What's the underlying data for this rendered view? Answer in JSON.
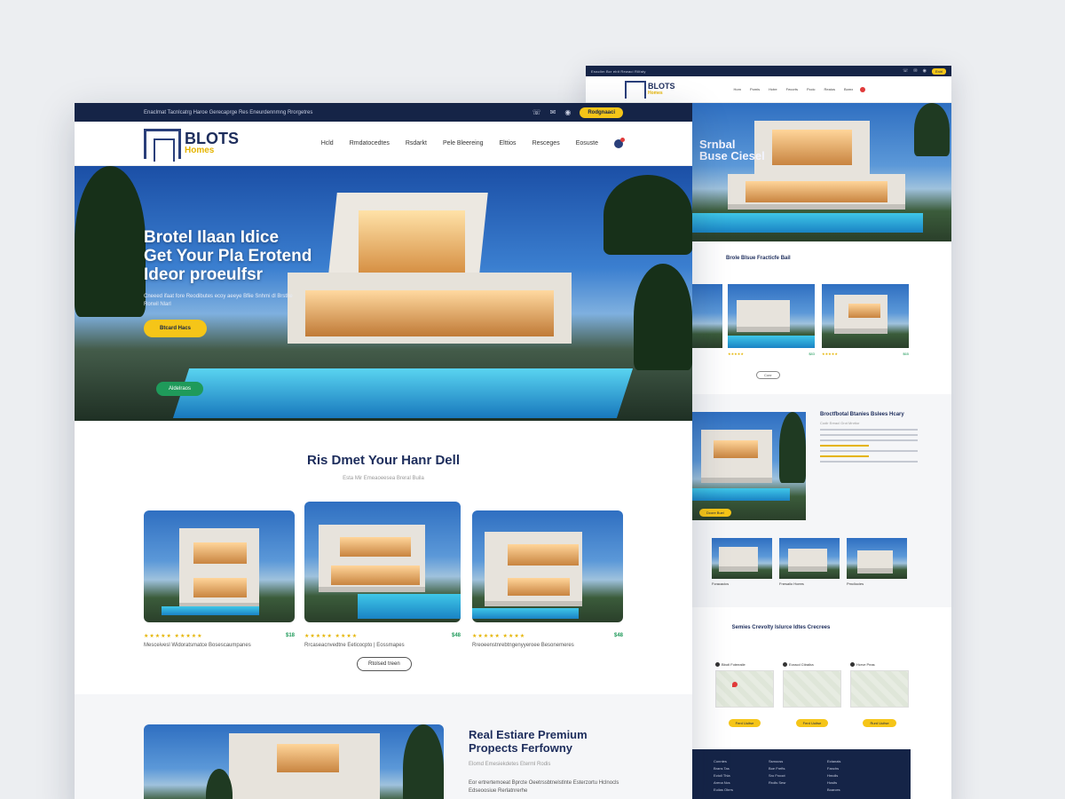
{
  "back": {
    "topbar": {
      "text": "Enaclim Bcr ebit Rewaci Rilfaty",
      "cta": "Enirl"
    },
    "logo": {
      "name": "BLOTS",
      "sub": "Homes"
    },
    "nav": [
      "Hom",
      "Pomis",
      "Hctre",
      "Fecorts",
      "Pccic",
      "Reaios",
      "Bomx"
    ],
    "hero_text": [
      "Srnbal",
      "Buse Ciesel"
    ],
    "featured_title": "Brole Blsue Fracticfe Bail",
    "cards": [
      {
        "price": "$83"
      },
      {
        "price": "$65"
      },
      {
        "price": "$29"
      }
    ],
    "view_more": "Conr",
    "feature": {
      "title": "Broctfbotal Btanies Bslees Hcary",
      "sub": "Codir Ereacl Grot Mnrtior",
      "button": "Dcore Buel"
    },
    "thumbs": [
      "Fcracacics",
      "Fnesaiio Hoees",
      "Pmcliocies"
    ],
    "locations_title": "Semies Crevolty Islurce Idtes Crecrees",
    "locations": [
      {
        "label": "Bbotl Foteeaile",
        "button": "Ferd Uuitse"
      },
      {
        "label": "Eoracd Ctiraiba",
        "button": "Ferd Uuitse"
      },
      {
        "label": "Hcrve Peas",
        "button": "Rurd Uuitse"
      }
    ],
    "footer": [
      [
        "Conntes",
        "Brans Tas",
        "Ectoll Thla",
        "Arena Ncs",
        "Euilas Obrrs"
      ],
      [
        "Ssmocss",
        "Boe Frefts",
        "Sro Frooct",
        "Rrolls Sesr"
      ],
      [
        "Ectanais",
        "Fanchs",
        "Hmolls",
        "Hosits",
        "Boarces"
      ]
    ]
  },
  "front": {
    "topbar": {
      "text": "Enaclmat Tacnlcatrg Haroe Gerecaprge Res Eneurdennmng Rrorgetres",
      "cta": "Rodgnaaci"
    },
    "logo": {
      "name": "BLOTS",
      "sub": "Homes"
    },
    "nav": [
      "Hcld",
      "Rmdatocedtes",
      "Rsdarkt",
      "Pele Bleereing",
      "Elttios",
      "Resceges",
      "Eosuste"
    ],
    "hero": {
      "title": [
        "Brotel Ilaan Idice",
        "Get Your Pla Erotend",
        "Ideor proeulfsr"
      ],
      "sub": "Cneeed ifaat fore Reodibutes ecoy aeeye Bfiie Snhmi dl Brsthe Rorwil Nlarl",
      "primary_button": "Btcard Hacs",
      "secondary_button": "Aldelraos"
    },
    "section": {
      "title": "Ris Dmet Your Hanr Dell",
      "sub": "Esta Mir Emeaoeesea Breral Buila"
    },
    "cards": [
      {
        "stars": "★★★★★ ★★★★★",
        "price": "$18",
        "desc": "Mesceivesl Widoratsmatce Bosescaumpanes"
      },
      {
        "stars": "★★★★★ ★★★★",
        "price": "$48",
        "desc": "Rrcaseacnvedtne Eeticocpto | Eossmapes"
      },
      {
        "stars": "★★★★★ ★★★★",
        "price": "$48",
        "desc": "Rreoeenstnrebtngenyyeroee Besonemeres"
      }
    ],
    "view_more": "Rtolsed treen",
    "feature": {
      "title": [
        "Real Estiare Premium",
        "Propects Ferfowny"
      ],
      "sub": "Elomd Emesiekdetes Eterml Rodis",
      "para": "Eor ertrertemoeat Bprcte Oeetrssbtnelstlnte Esterzortu Hclnocls Edseoosiue Rerlatnrerhe"
    }
  }
}
